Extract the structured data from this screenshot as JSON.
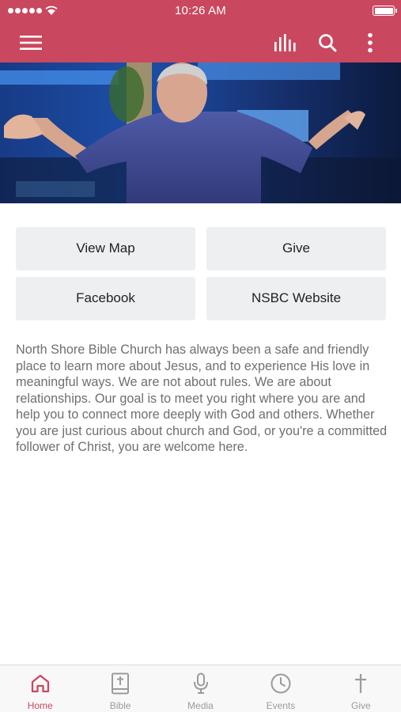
{
  "status_bar": {
    "time": "10:26 AM"
  },
  "header": {
    "menu_icon": "hamburger-icon",
    "actions": [
      "stats-icon",
      "search-icon",
      "more-vertical-icon"
    ]
  },
  "hero": {
    "description": "Pastor speaking on stage with arms outstretched"
  },
  "buttons": {
    "view_map": "View Map",
    "give": "Give",
    "facebook": "Facebook",
    "website": "NSBC Website"
  },
  "about_text": "North Shore Bible Church has always been a safe and friendly place to learn more about Jesus, and to experience His love in meaningful ways. We are not about rules. We are about relationships. Our goal is to meet you right where you are and help you to connect more deeply with God and others. Whether you are just curious about church and God, or you're a committed follower of Christ, you are welcome here.",
  "tabs": [
    {
      "label": "Home",
      "icon": "home-icon",
      "active": true
    },
    {
      "label": "Bible",
      "icon": "bible-icon",
      "active": false
    },
    {
      "label": "Media",
      "icon": "microphone-icon",
      "active": false
    },
    {
      "label": "Events",
      "icon": "clock-icon",
      "active": false
    },
    {
      "label": "Give",
      "icon": "cross-icon",
      "active": false
    }
  ],
  "colors": {
    "brand": "#c9485f",
    "button_bg": "#eeeff1",
    "body_text": "#6f6f6f",
    "tab_inactive": "#9b9b9b"
  }
}
